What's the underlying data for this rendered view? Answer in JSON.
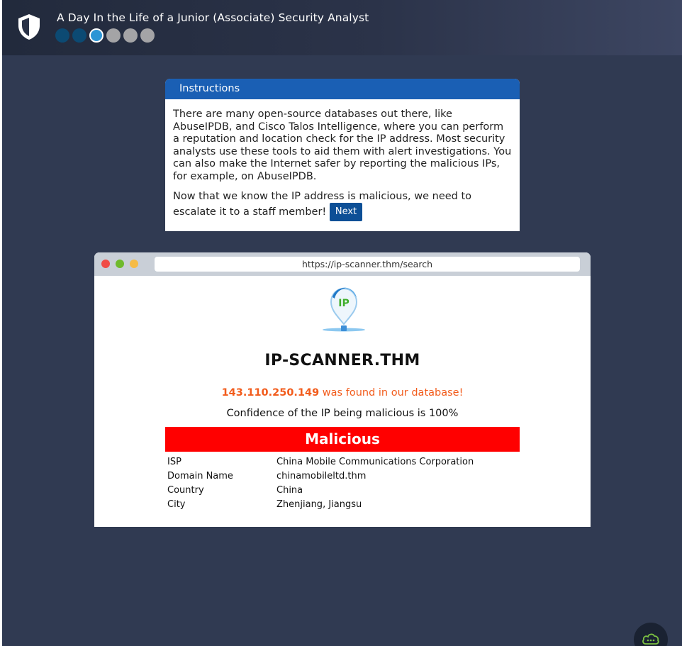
{
  "header": {
    "title": "A Day In the Life of a Junior (Associate) Security Analyst",
    "logo_icon": "shield-icon",
    "progress": {
      "total_steps": 6,
      "current_step": 3,
      "completed_steps": 2
    }
  },
  "instructions": {
    "heading": "Instructions",
    "paragraph_1": "There are many open-source databases out there, like AbuseIPDB, and Cisco Talos Intelligence, where you can perform a reputation and location check for the IP address. Most security analysts use these tools to aid them with alert investigations. You can also make the Internet safer by reporting the malicious IPs, for example, on AbuseIPDB.",
    "paragraph_2": "Now that we know the IP address is malicious, we need to escalate it to a staff member!",
    "next_label": "Next"
  },
  "browser": {
    "url": "https://ip-scanner.thm/search",
    "site": {
      "logo_text": "IP",
      "title": "IP-SCANNER.THM",
      "ip": "143.110.250.149",
      "found_suffix": " was found in our database!",
      "confidence": "Confidence of the IP being malicious is 100%",
      "verdict": "Malicious",
      "details": [
        {
          "label": "ISP",
          "value": "China Mobile Communications Corporation"
        },
        {
          "label": "Domain Name",
          "value": "chinamobileltd.thm"
        },
        {
          "label": "Country",
          "value": "China"
        },
        {
          "label": "City",
          "value": "Zhenjiang, Jiangsu"
        }
      ]
    }
  },
  "colors": {
    "background": "#303a52",
    "accent_blue": "#1a5fb4",
    "next_button": "#0d4f96",
    "verdict_red": "#ff0000",
    "found_orange": "#f25c1c"
  },
  "chat_icon": "chat-cloud-icon"
}
